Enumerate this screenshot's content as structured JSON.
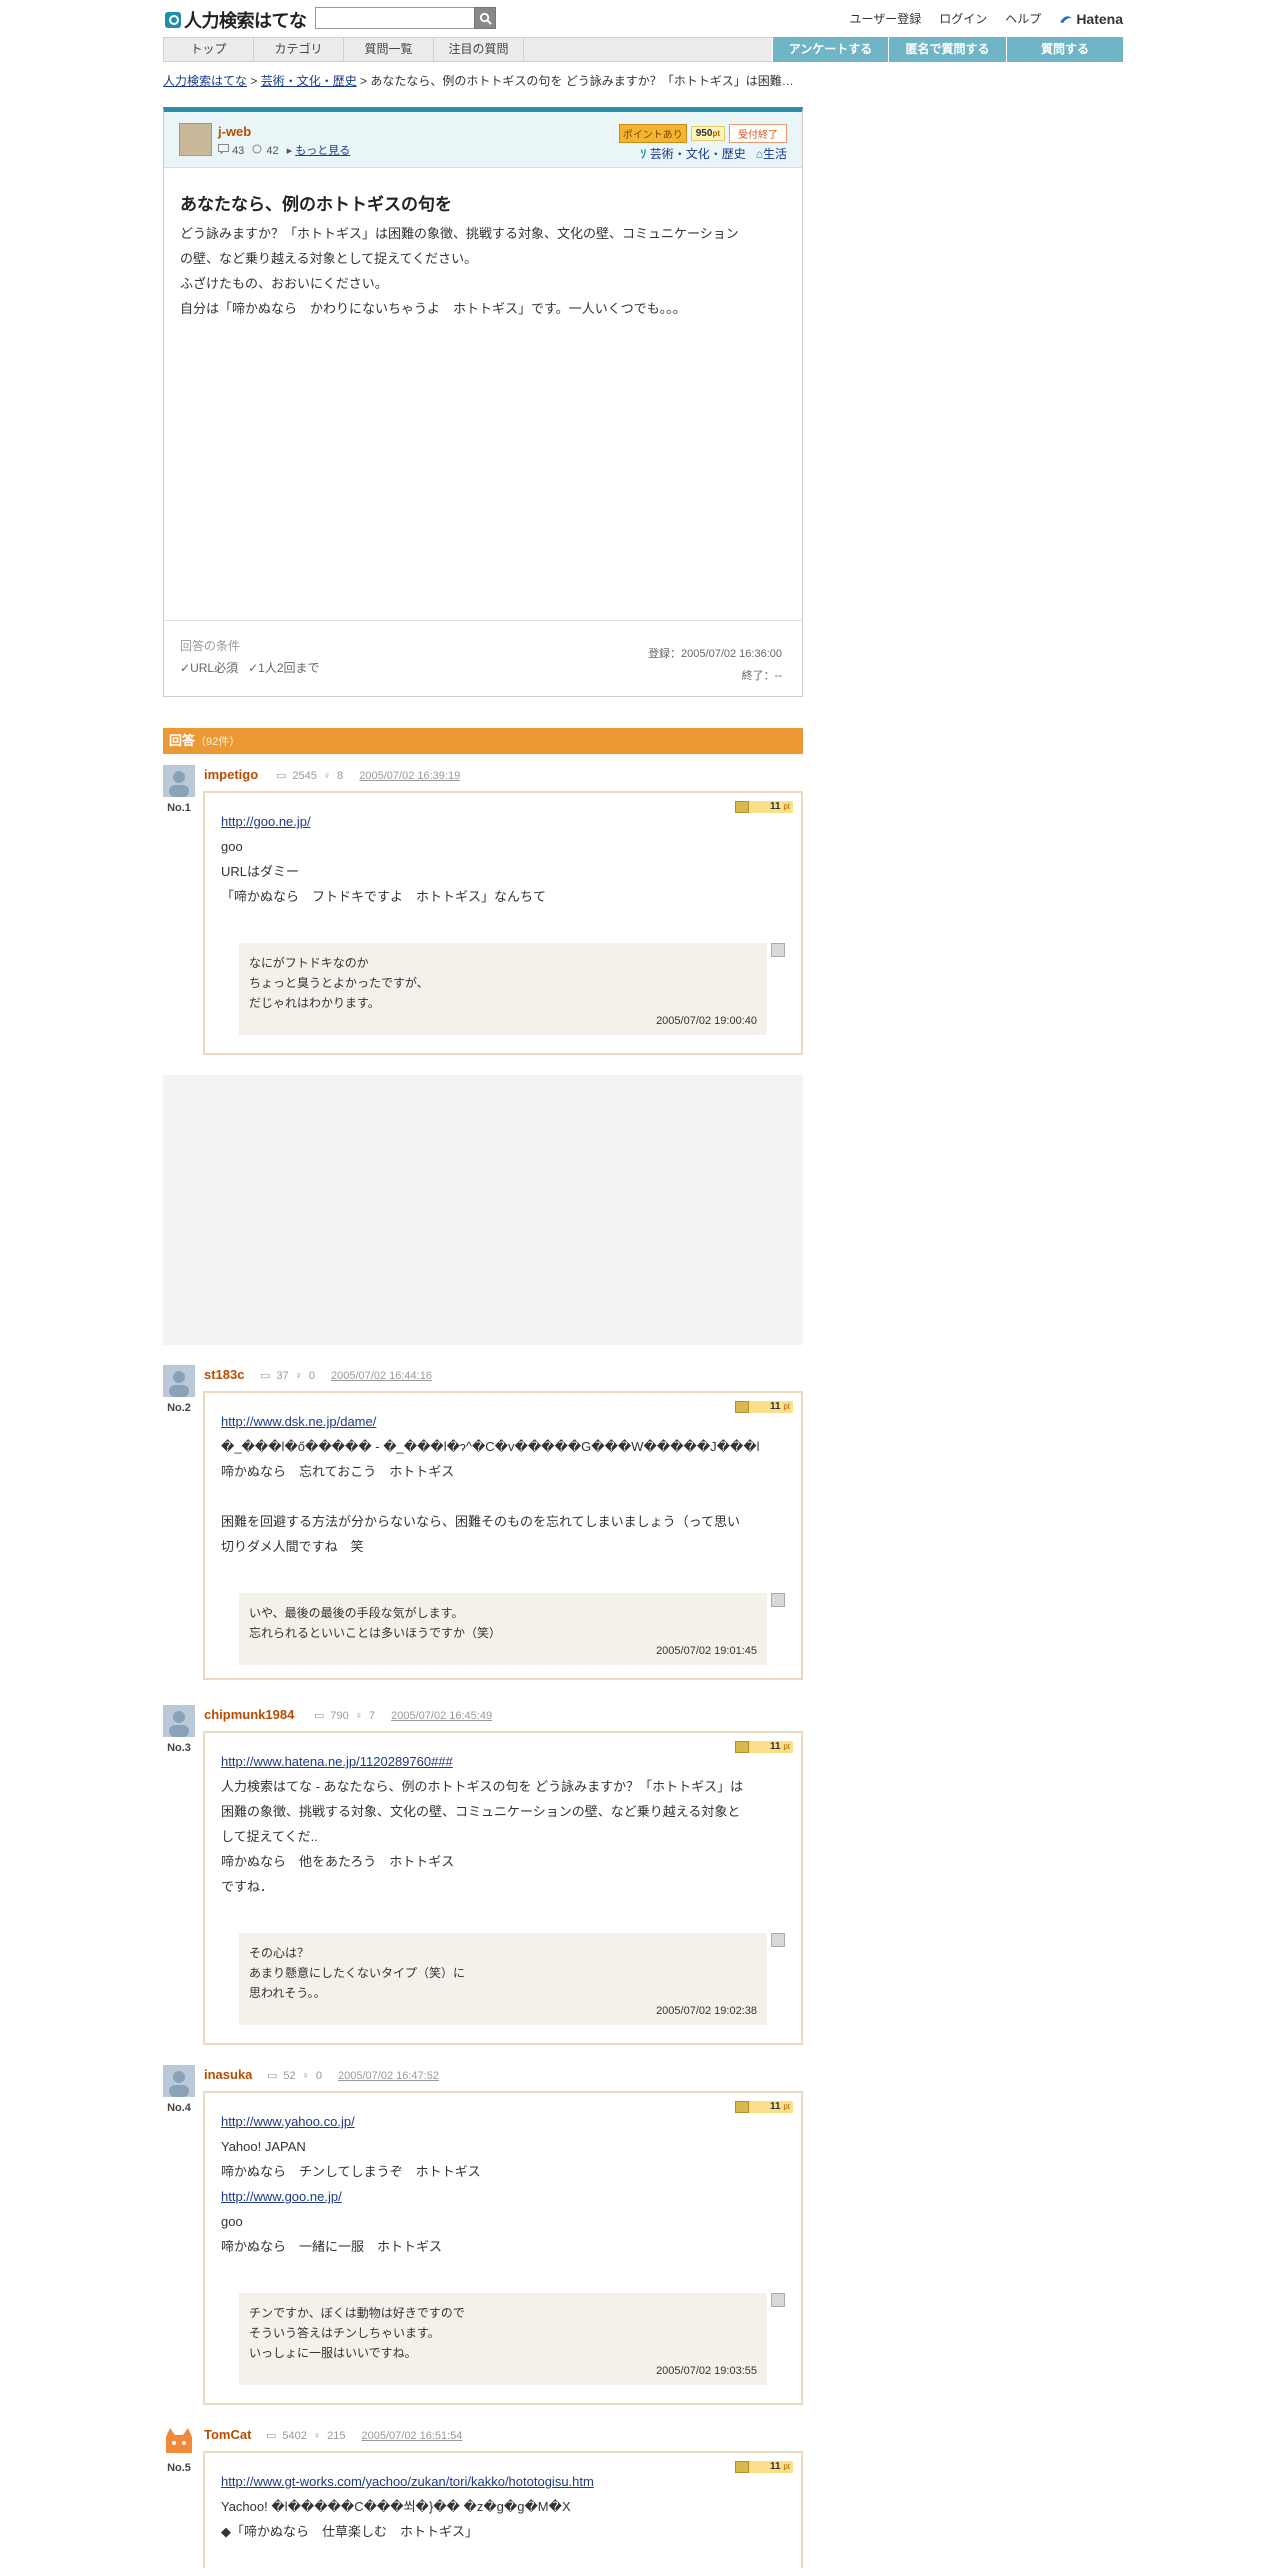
{
  "header": {
    "logo_text": "人力検索はてな",
    "search_placeholder": "",
    "links": [
      "ユーザー登録",
      "ログイン",
      "ヘルプ"
    ],
    "brand": "Hatena"
  },
  "nav": {
    "tabs": [
      "トップ",
      "カテゴリ",
      "質問一覧",
      "注目の質問"
    ],
    "buttons": [
      "アンケートする",
      "匿名で質問する",
      "質問する"
    ]
  },
  "breadcrumb": {
    "home": "人力検索はてな",
    "sep1": " > ",
    "category": "芸術・文化・歴史",
    "rest": " > あなたなら、例のホトトギスの句を どう詠みますか？「ホトトギス」は困難…"
  },
  "question": {
    "user": "j-web",
    "answers_count": "43",
    "questions_count": "42",
    "more_label": "もっと見る",
    "point_label": "ポイントあり",
    "points": "950",
    "point_unit": "pt",
    "status": "受付終了",
    "category": "芸術・文化・歴史",
    "subcategory": "生活",
    "title": "あなたなら、例のホトトギスの句を",
    "body": [
      "どう詠みますか？「ホトトギス」は困難の象徴、挑戦する対象、文化の壁、コミュニケーション",
      "の壁、など乗り越える対象として捉えてください。",
      "ふざけたもの、おおいにください。",
      "自分は「啼かぬなら　かわりにないちゃうよ　ホトトギス」です。一人いくつでも。。。"
    ],
    "conditions_label": "回答の条件",
    "conditions": [
      "URL必須",
      "1人2回まで"
    ],
    "registered": "登録：2005/07/02 16:36:00",
    "closed": "終了：--"
  },
  "answers_header": {
    "label": "回答",
    "count": "（92件）"
  },
  "answers": [
    {
      "no": "No.1",
      "user": "impetigo",
      "a_count": "2545",
      "q_count": "8",
      "date": "2005/07/02 16:39:19",
      "points": "11",
      "unit": "pt",
      "lines": [
        "http://goo.ne.jp/",
        "goo",
        "URLはダミー",
        "「啼かぬなら　フトドキですよ　ホトトギス」なんちて"
      ],
      "reply": [
        "なにがフトドキなのか",
        "ちょっと臭うとよかったですが、",
        "だじゃれはわかります。"
      ],
      "reply_date": "2005/07/02 19:00:40"
    },
    {
      "no": "No.2",
      "user": "st183c",
      "a_count": "37",
      "q_count": "0",
      "date": "2005/07/02 16:44:16",
      "points": "11",
      "unit": "pt",
      "lines": [
        "http://www.dsk.ne.jp/dame/",
        "�_���l�ő����� - �_���l�ɂ^�C�v�����G���W�����J���l",
        "啼かぬなら　忘れておこう　ホトトギス",
        "",
        "困難を回避する方法が分からないなら、困難そのものを忘れてしまいましょう（って思い",
        "切りダメ人間ですね　笑"
      ],
      "reply": [
        "いや、最後の最後の手段な気がします。",
        "忘れられるといいことは多いほうですか（笑）"
      ],
      "reply_date": "2005/07/02 19:01:45"
    },
    {
      "no": "No.3",
      "user": "chipmunk1984",
      "a_count": "790",
      "q_count": "7",
      "date": "2005/07/02 16:45:49",
      "points": "11",
      "unit": "pt",
      "lines": [
        "http://www.hatena.ne.jp/1120289760###",
        "人力検索はてな - あなたなら、例のホトトギスの句を どう詠みますか？「ホトトギス」は",
        "困難の象徴、挑戦する対象、文化の壁、コミュニケーションの壁、など乗り越える対象と",
        "して捉えてくだ..",
        "啼かぬなら　他をあたろう　ホトトギス",
        "ですね．"
      ],
      "reply": [
        "その心は？",
        "あまり懸意にしたくないタイプ（笑）に",
        "思われそう。。"
      ],
      "reply_date": "2005/07/02 19:02:38"
    },
    {
      "no": "No.4",
      "user": "inasuka",
      "a_count": "52",
      "q_count": "0",
      "date": "2005/07/02 16:47:52",
      "points": "11",
      "unit": "pt",
      "lines": [
        "http://www.yahoo.co.jp/",
        "Yahoo! JAPAN",
        "啼かぬなら　チンしてしまうぞ　ホトトギス",
        "http://www.goo.ne.jp/",
        "goo",
        "啼かぬなら　一緒に一服　ホトトギス"
      ],
      "reply": [
        "チンですか、ぼくは動物は好きですので",
        "そういう答えはチンしちゃいます。",
        "いっしょに一服はいいですね。"
      ],
      "reply_date": "2005/07/02 19:03:55"
    },
    {
      "no": "No.5",
      "user": "TomCat",
      "a_count": "5402",
      "q_count": "215",
      "date": "2005/07/02 16:51:54",
      "points": "11",
      "unit": "pt",
      "lines": [
        "http://www.gt-works.com/yachoo/zukan/tori/kakko/hototogisu.htm",
        "Yachoo! �l�����C���쐬�}�� �z�g�g�M�X",
        "◆「啼かぬなら　仕草楽しむ　ホトトギス」"
      ],
      "reply": [],
      "reply_date": ""
    }
  ]
}
